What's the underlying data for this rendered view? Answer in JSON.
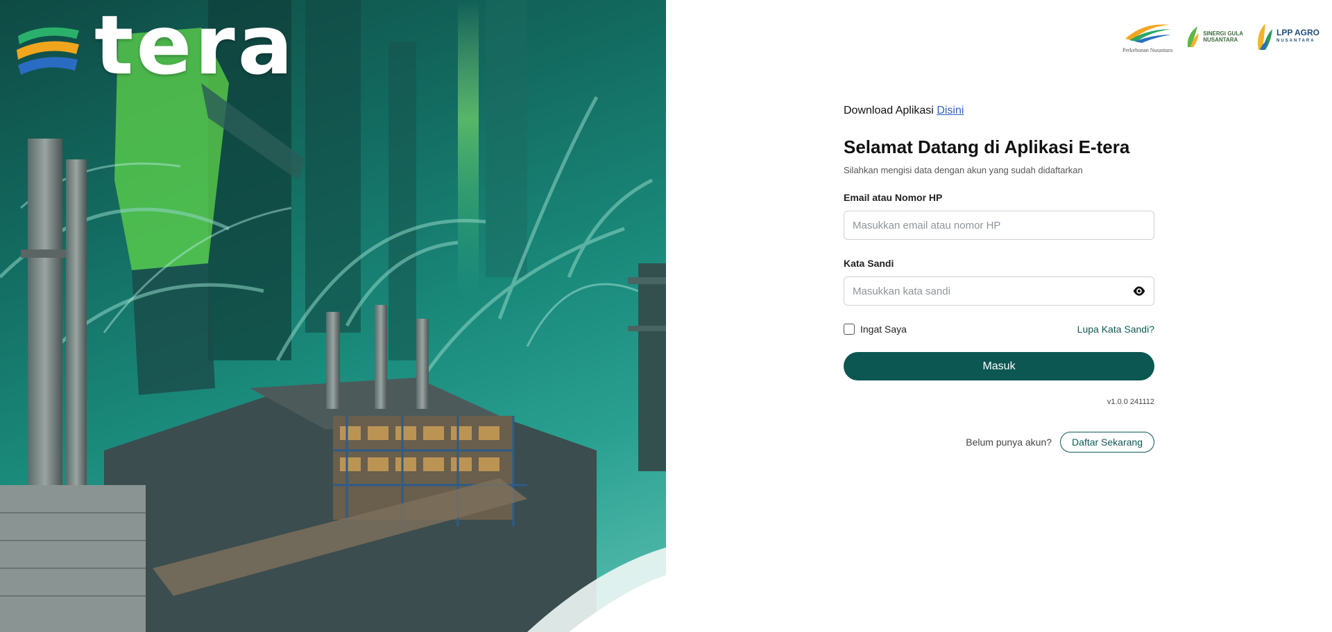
{
  "brand": {
    "wordmark": "tera"
  },
  "partners": {
    "ptpn_caption": "Perkebunan Nusantara",
    "sgn_line1": "SINERGI GULA",
    "sgn_line2": "NUSANTARA",
    "lpp_line1": "LPP AGRO",
    "lpp_line2": "NUSANTARA"
  },
  "download": {
    "text": "Download Aplikasi",
    "link_label": "Disini"
  },
  "form": {
    "title": "Selamat Datang di Aplikasi E-tera",
    "subtitle": "Silahkan mengisi data dengan akun yang sudah didaftarkan",
    "email_label": "Email atau Nomor HP",
    "email_placeholder": "Masukkan email atau nomor HP",
    "email_value": "",
    "password_label": "Kata Sandi",
    "password_placeholder": "Masukkan kata sandi",
    "password_value": "",
    "remember_label": "Ingat Saya",
    "remember_checked": false,
    "forgot_label": "Lupa Kata Sandi?",
    "submit_label": "Masuk",
    "version": "v1.0.0 241112"
  },
  "register": {
    "question": "Belum punya akun?",
    "button_label": "Daftar Sekarang"
  },
  "colors": {
    "primary": "#0c5752",
    "link": "#2b5fc4",
    "hero_teal": "#1a8a7b"
  },
  "icons": {
    "password_toggle": "eye-icon"
  }
}
